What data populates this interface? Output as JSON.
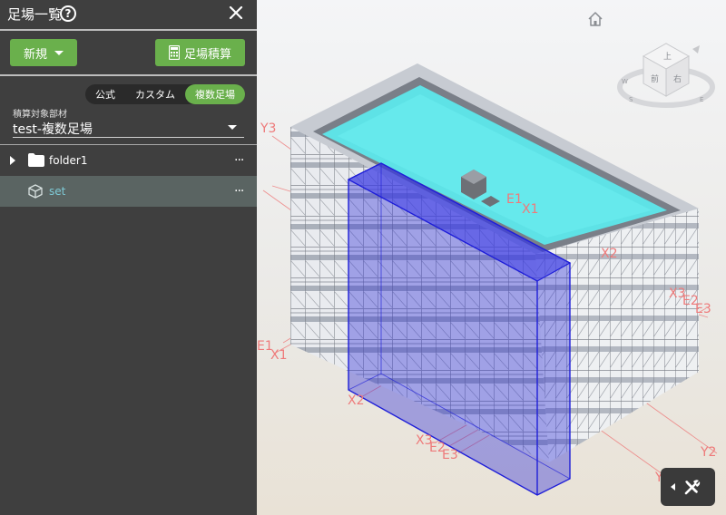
{
  "panel": {
    "title": "足場一覧",
    "new_button": "新規",
    "calc_button": "足場積算",
    "segments": [
      "公式",
      "カスタム",
      "複数足場"
    ],
    "active_segment": "複数足場",
    "target_label": "積算対象部材",
    "target_value": "test-複数足場",
    "tree": [
      {
        "label": "folder1",
        "icon": "folder-icon",
        "more": "···"
      },
      {
        "label": "set",
        "icon": "cube-icon",
        "more": "···",
        "selected": true
      }
    ]
  },
  "viewer": {
    "grid_labels": {
      "y3": "Y3",
      "e1_top": "E1",
      "x1_top": "X1",
      "x2_right": "X2",
      "x3_right": "X3",
      "e2_right": "E2",
      "e3_right": "E3",
      "e1_left": "E1",
      "x1_left": "X1",
      "x2_left": "X2",
      "x3_bottom": "X3",
      "e2_bottom": "E2",
      "e3_bottom": "E3",
      "y2": "Y2",
      "y_bottom": "Y"
    },
    "viewcube_faces": {
      "top": "上",
      "front": "前",
      "right": "右"
    },
    "compass": {
      "w": "W",
      "s": "S",
      "e": "E"
    }
  },
  "colors": {
    "accent": "#6ab04c",
    "roof": "#5fe3e6",
    "selection_box": "#2a2ad8",
    "grid_line": "#ee7a7a"
  }
}
